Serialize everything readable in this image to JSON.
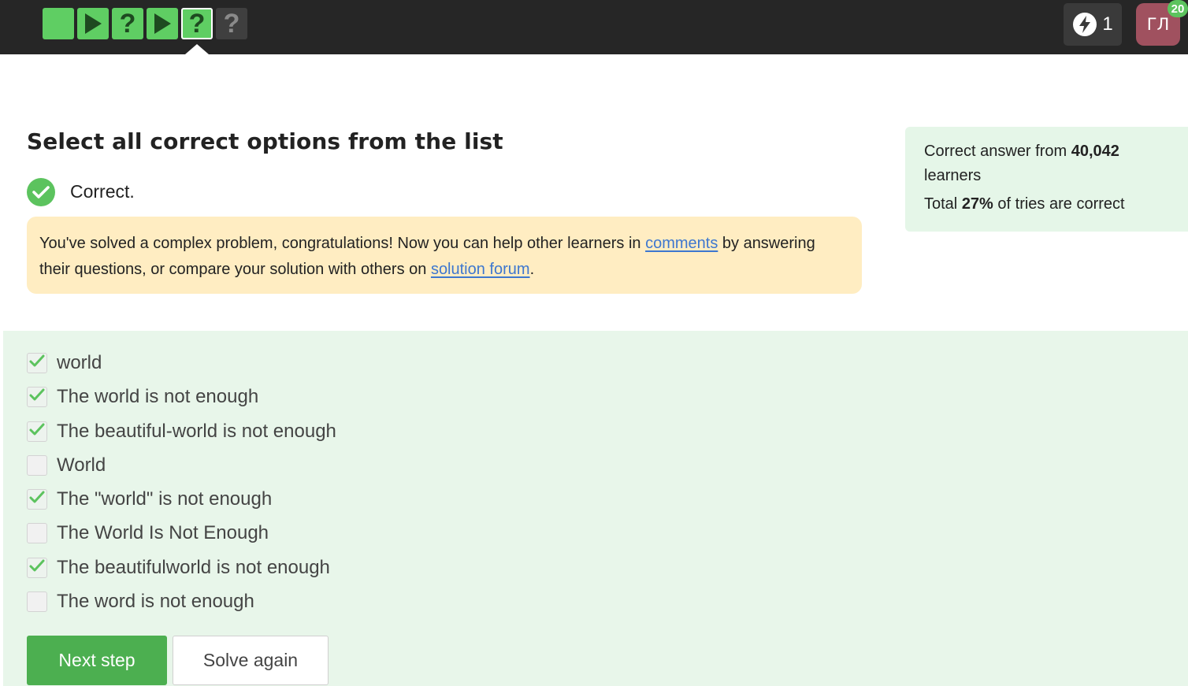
{
  "colors": {
    "topbar_bg": "#262626",
    "step_green": "#5fce63",
    "step_gray": "#3f3f3f",
    "accent_green": "#4caf50",
    "success_green": "#5cc35e",
    "congrats_bg": "#ffedc2",
    "stats_bg": "#e5f6e8",
    "options_bg": "#e8f6ea",
    "link": "#3d77cf",
    "avatar_bg": "#a0515f"
  },
  "header": {
    "steps": [
      {
        "type": "text",
        "icon": "blank-square-icon",
        "state": "solved"
      },
      {
        "type": "video",
        "icon": "play-icon",
        "glyph": "",
        "state": "solved"
      },
      {
        "type": "quiz",
        "icon": "question-icon",
        "glyph": "?",
        "state": "solved"
      },
      {
        "type": "video",
        "icon": "play-icon",
        "glyph": "",
        "state": "solved"
      },
      {
        "type": "quiz",
        "icon": "question-icon",
        "glyph": "?",
        "state": "solved-current"
      },
      {
        "type": "quiz",
        "icon": "question-icon",
        "glyph": "?",
        "state": "unsolved"
      }
    ],
    "energy": {
      "icon": "lightning-icon",
      "count": "1"
    },
    "avatar": {
      "initials": "ГЛ",
      "notifications": "20"
    }
  },
  "task": {
    "title": "Select all correct options from the list",
    "status_icon": "check-circle-icon",
    "status": "Correct.",
    "congrats": {
      "text_before": "You've solved a complex problem, congratulations! Now you can help other learners in ",
      "link1": "comments",
      "text_middle": " by answering their questions, or compare your solution with others on ",
      "link2": "solution forum",
      "text_after": "."
    }
  },
  "stats": {
    "line1_prefix": "Correct answer from ",
    "learners_count": "40,042",
    "line1_suffix": " learners",
    "line2_prefix": "Total ",
    "percent": "27%",
    "line2_suffix": " of tries are correct"
  },
  "options": [
    {
      "label": "world",
      "checked": true
    },
    {
      "label": "The world is not enough",
      "checked": true
    },
    {
      "label": "The beautiful-world is not enough",
      "checked": true
    },
    {
      "label": "World",
      "checked": false
    },
    {
      "label": "The \"world\" is not enough",
      "checked": true
    },
    {
      "label": "The World Is Not Enough",
      "checked": false
    },
    {
      "label": "The beautifulworld is not enough",
      "checked": true
    },
    {
      "label": "The word is not enough",
      "checked": false
    }
  ],
  "actions": {
    "next_label": "Next step",
    "again_label": "Solve again"
  }
}
